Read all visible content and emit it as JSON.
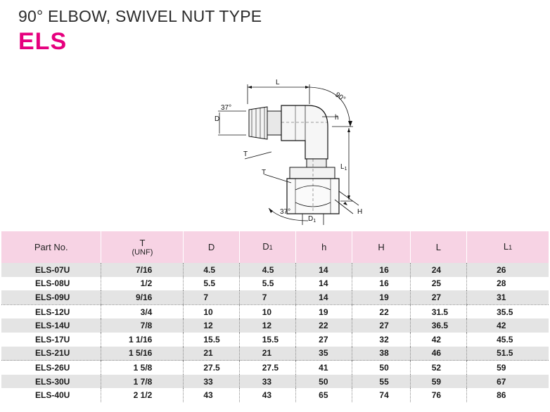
{
  "header": {
    "title": "90° ELBOW, SWIVEL NUT TYPE",
    "code": "ELS"
  },
  "drawing": {
    "labels": {
      "L": "L",
      "angle_90": "90°",
      "angle_37_top": "37°",
      "D": "D",
      "h": "h",
      "T_top": "T",
      "T_bottom": "T",
      "L1": "L",
      "L1_sub": "1",
      "angle_37_bottom": "37°",
      "D1": "D",
      "D1_sub": "1",
      "H": "H"
    }
  },
  "table": {
    "headers": [
      {
        "main": "Part No.",
        "sub": ""
      },
      {
        "main": "T",
        "sub": "(UNF)"
      },
      {
        "main": "D",
        "sub": ""
      },
      {
        "main": "D",
        "subscript": "1"
      },
      {
        "main": "h",
        "sub": ""
      },
      {
        "main": "H",
        "sub": ""
      },
      {
        "main": "L",
        "sub": ""
      },
      {
        "main": "L",
        "subscript": "1"
      }
    ],
    "rows": [
      [
        "ELS-07U",
        "7/16",
        "4.5",
        "4.5",
        "14",
        "16",
        "24",
        "26"
      ],
      [
        "ELS-08U",
        "1/2",
        "5.5",
        "5.5",
        "14",
        "16",
        "25",
        "28"
      ],
      [
        "ELS-09U",
        "9/16",
        "7",
        "7",
        "14",
        "19",
        "27",
        "31"
      ],
      [
        "ELS-12U",
        "3/4",
        "10",
        "10",
        "19",
        "22",
        "31.5",
        "35.5"
      ],
      [
        "ELS-14U",
        "7/8",
        "12",
        "12",
        "22",
        "27",
        "36.5",
        "42"
      ],
      [
        "ELS-17U",
        "1 1/16",
        "15.5",
        "15.5",
        "27",
        "32",
        "42",
        "45.5"
      ],
      [
        "ELS-21U",
        "1 5/16",
        "21",
        "21",
        "35",
        "38",
        "46",
        "51.5"
      ],
      [
        "ELS-26U",
        "1 5/8",
        "27.5",
        "27.5",
        "41",
        "50",
        "52",
        "59"
      ],
      [
        "ELS-30U",
        "1 7/8",
        "33",
        "33",
        "50",
        "55",
        "59",
        "67"
      ],
      [
        "ELS-40U",
        "2 1/2",
        "43",
        "43",
        "65",
        "74",
        "76",
        "86"
      ]
    ]
  }
}
